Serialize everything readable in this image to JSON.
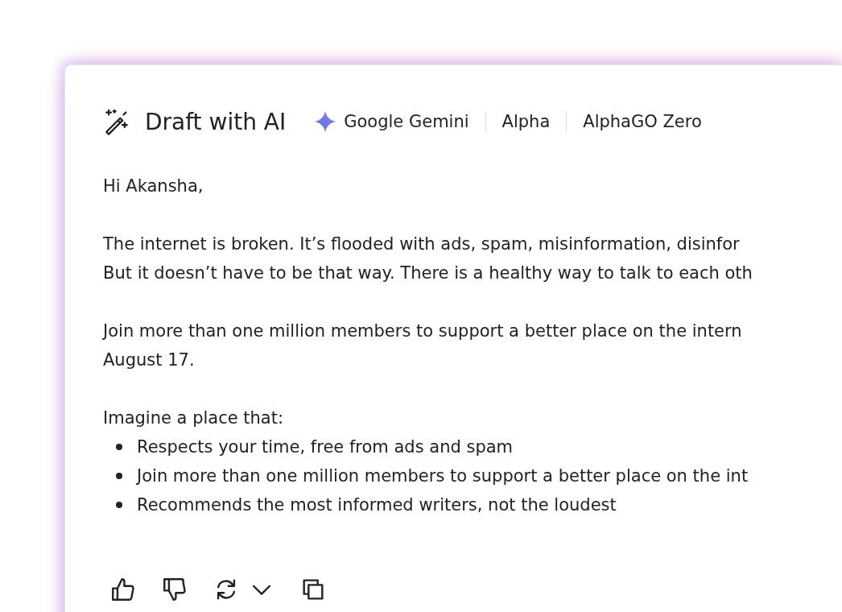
{
  "header": {
    "title": "Draft with AI",
    "models": [
      {
        "name": "Google Gemini",
        "kind": "gemini"
      },
      {
        "name": "Alpha",
        "kind": "plain"
      },
      {
        "name": "AlphaGO Zero",
        "kind": "plain"
      }
    ]
  },
  "draft": {
    "greeting": "Hi Akansha,",
    "paragraphs": [
      [
        "The internet is broken. It’s flooded with ads, spam, misinformation, disinfor",
        "But it doesn’t have to be that way. There is a healthy way to talk to each oth"
      ],
      [
        "Join more than one million members to support a better place on the intern",
        "August 17."
      ]
    ],
    "list_intro": "Imagine a place that:",
    "bullets": [
      "Respects your time, free from ads and spam",
      "Join more than one million members to support a better place on the int",
      "Recommends the most informed writers, not the loudest"
    ]
  },
  "actions": [
    {
      "kind": "like"
    },
    {
      "kind": "dislike"
    },
    {
      "kind": "regenerate"
    },
    {
      "kind": "more"
    },
    {
      "kind": "copy"
    }
  ]
}
